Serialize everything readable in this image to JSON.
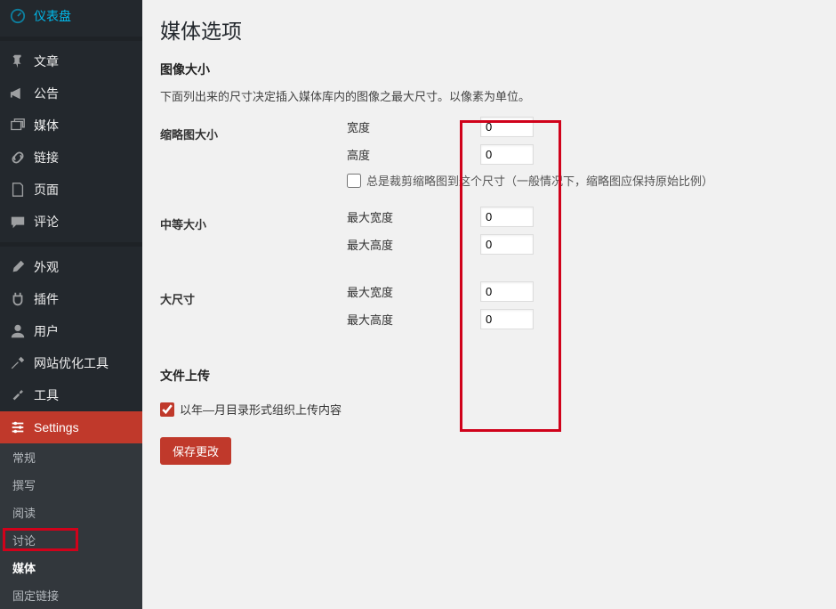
{
  "sidebar": {
    "items": [
      {
        "label": "仪表盘"
      },
      {
        "label": "文章"
      },
      {
        "label": "公告"
      },
      {
        "label": "媒体"
      },
      {
        "label": "链接"
      },
      {
        "label": "页面"
      },
      {
        "label": "评论"
      },
      {
        "label": "外观"
      },
      {
        "label": "插件"
      },
      {
        "label": "用户"
      },
      {
        "label": "网站优化工具"
      },
      {
        "label": "工具"
      },
      {
        "label": "Settings"
      }
    ],
    "submenu": [
      {
        "label": "常规"
      },
      {
        "label": "撰写"
      },
      {
        "label": "阅读"
      },
      {
        "label": "讨论"
      },
      {
        "label": "媒体"
      },
      {
        "label": "固定链接"
      }
    ]
  },
  "page": {
    "title": "媒体选项",
    "section_image_sizes": "图像大小",
    "image_sizes_desc": "下面列出来的尺寸决定插入媒体库内的图像之最大尺寸。以像素为单位。",
    "thumb": {
      "label": "缩略图大小",
      "width_label": "宽度",
      "width_value": "0",
      "height_label": "高度",
      "height_value": "0",
      "crop_label": "总是裁剪缩略图到这个尺寸（一般情况下，缩略图应保持原始比例）"
    },
    "medium": {
      "label": "中等大小",
      "max_width_label": "最大宽度",
      "max_width_value": "0",
      "max_height_label": "最大高度",
      "max_height_value": "0"
    },
    "large": {
      "label": "大尺寸",
      "max_width_label": "最大宽度",
      "max_width_value": "0",
      "max_height_label": "最大高度",
      "max_height_value": "0"
    },
    "section_upload": "文件上传",
    "organize_by_date_label": "以年—月目录形式组织上传内容",
    "save_button": "保存更改"
  }
}
